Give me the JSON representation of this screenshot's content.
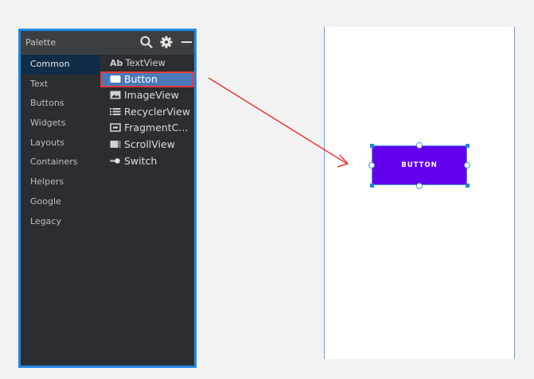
{
  "palette": {
    "title": "Palette",
    "header_icons": [
      "search-icon",
      "gear-icon",
      "minimize-icon"
    ],
    "categories": [
      {
        "label": "Common",
        "selected": true
      },
      {
        "label": "Text"
      },
      {
        "label": "Buttons"
      },
      {
        "label": "Widgets"
      },
      {
        "label": "Layouts"
      },
      {
        "label": "Containers"
      },
      {
        "label": "Helpers"
      },
      {
        "label": "Google"
      },
      {
        "label": "Legacy"
      }
    ],
    "widgets": [
      {
        "label": "TextView",
        "icon": "ab-icon",
        "icon_text": "Ab"
      },
      {
        "label": "Button",
        "icon": "button-icon",
        "selected": true
      },
      {
        "label": "ImageView",
        "icon": "image-icon"
      },
      {
        "label": "RecyclerView",
        "icon": "list-icon"
      },
      {
        "label": "FragmentC...",
        "icon": "fragment-icon"
      },
      {
        "label": "ScrollView",
        "icon": "scroll-icon"
      },
      {
        "label": "Switch",
        "icon": "switch-icon"
      }
    ]
  },
  "canvas": {
    "button_label": "BUTTON",
    "button_color": "#6200ee"
  },
  "colors": {
    "panel_border": "#1e88e5",
    "highlight_border": "#e53935",
    "arrow": "#e53935",
    "selection": "#4a78b8"
  }
}
